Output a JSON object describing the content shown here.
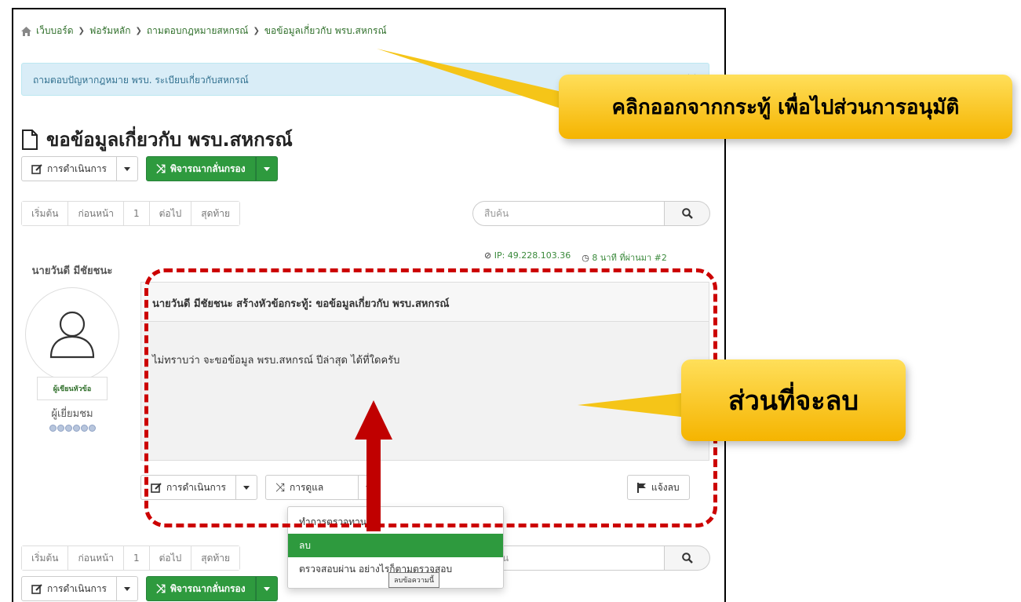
{
  "breadcrumb": {
    "items": [
      "เว็บบอร์ด",
      "ฟอรัมหลัก",
      "ถามตอบกฎหมายสหกรณ์",
      "ขอข้อมูลเกี่ยวกับ พรบ.สหกรณ์"
    ]
  },
  "alert": {
    "text": "ถามตอบปัญหากฎหมาย พรบ. ระเบียบเกี่ยวกับสหกรณ์",
    "close": "×"
  },
  "page": {
    "title": "ขอข้อมูลเกี่ยวกับ พรบ.สหกรณ์"
  },
  "toolbar": {
    "actions_label": "การดำเนินการ",
    "moderate_label": "พิจารณากลั่นกรอง",
    "manage_label": "การดูแล",
    "report_label": "แจ้งลบ"
  },
  "pagination": {
    "first": "เริ่มต้น",
    "prev": "ก่อนหน้า",
    "page": "1",
    "next": "ต่อไป",
    "last": "สุดท้าย"
  },
  "search": {
    "placeholder": "สืบค้น"
  },
  "post": {
    "ip": "IP: 49.228.103.36",
    "time": "8 นาที ที่ผ่านมา",
    "number": "#2",
    "author_name": "นายวันดี มีชัยชนะ",
    "author_role": "ผู้เขียนหัวข้อ",
    "author_rank": "ผู้เยี่ยมชม",
    "rank_dots": 6,
    "header": "นายวันดี มีชัยชนะ สร้างหัวข้อกระทู้: ขอข้อมูลเกี่ยวกับ พรบ.สหกรณ์",
    "body": "ไม่ทราบว่า จะขอข้อมูล พรบ.สหกรณ์ ปีล่าสุด ได้ที่ใดครับ"
  },
  "dropdown": {
    "items": [
      "ทำการตรวจทาน",
      "ลบ",
      "ตรวจสอบผ่าน อย่างไรก็ตามตรวจสอบ"
    ],
    "active_index": 1,
    "tooltip": "ลบข้อความนี้"
  },
  "callouts": {
    "exit_note": "คลิกออกจากกระทู้ เพื่อไปส่วนการอนุมัติ",
    "delete_note": "ส่วนที่จะลบ"
  },
  "colors": {
    "accent_green": "#2e9a3e",
    "annotation_red": "#cc0000",
    "callout_yellow": "#f5b400",
    "alert_blue": "#d9edf7"
  }
}
